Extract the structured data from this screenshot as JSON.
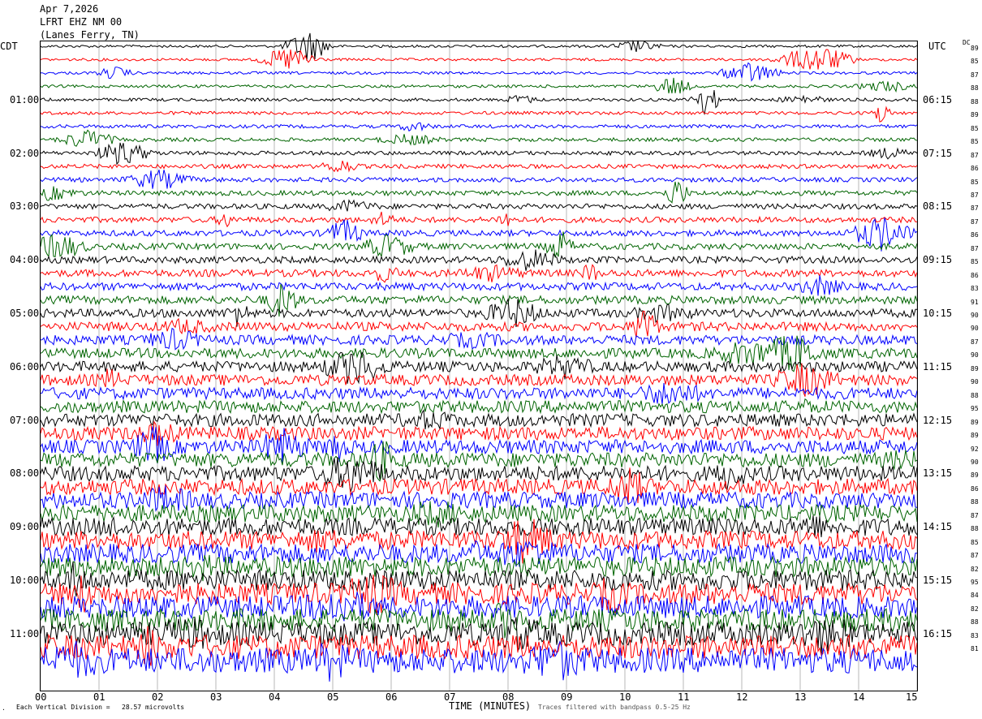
{
  "header": {
    "date": "Apr 7,2026",
    "station": "LFRT EHZ NM 00",
    "location": "(Lanes Ferry, TN)"
  },
  "left_axis_title": "CDT",
  "right_axis_title": "UTC",
  "dc_title": "DC",
  "bottom": {
    "xlabel": "TIME (MINUTES)",
    "scale_note": "Each Vertical Division =   28.57 microvolts",
    "footer_right": "Traces filtered with bandpass 0.5-25 Hz"
  },
  "chart_data": {
    "type": "line",
    "chart_kind": "helicorder seismogram",
    "x_ticks": [
      "00",
      "01",
      "02",
      "03",
      "04",
      "05",
      "06",
      "07",
      "08",
      "09",
      "10",
      "11",
      "12",
      "13",
      "14",
      "15"
    ],
    "xlim": [
      0,
      15
    ],
    "left_time_labels": [
      "01:00",
      "02:00",
      "03:00",
      "04:00",
      "05:00",
      "06:00",
      "07:00",
      "08:00",
      "09:00",
      "10:00",
      "11:00"
    ],
    "right_time_labels": [
      "06:15",
      "07:15",
      "08:15",
      "09:15",
      "10:15",
      "11:15",
      "12:15",
      "13:15",
      "14:15",
      "15:15",
      "16:15"
    ],
    "dc_offsets": [
      "89",
      "85",
      "87",
      "88",
      "88",
      "89",
      "85",
      "85",
      "87",
      "86",
      "85",
      "87",
      "87",
      "87",
      "86",
      "87",
      "85",
      "86",
      "83",
      "91",
      "90",
      "90",
      "87",
      "90",
      "89",
      "90",
      "88",
      "95",
      "89",
      "89",
      "92",
      "90",
      "89",
      "86",
      "88",
      "87",
      "88",
      "85",
      "87",
      "82",
      "95",
      "84",
      "82",
      "88",
      "83",
      "81"
    ],
    "trace_colors": [
      "#000000",
      "#ff0000",
      "#0000ff",
      "#006400"
    ],
    "trace_count": 47,
    "grid": "vertical lines at each minute"
  }
}
